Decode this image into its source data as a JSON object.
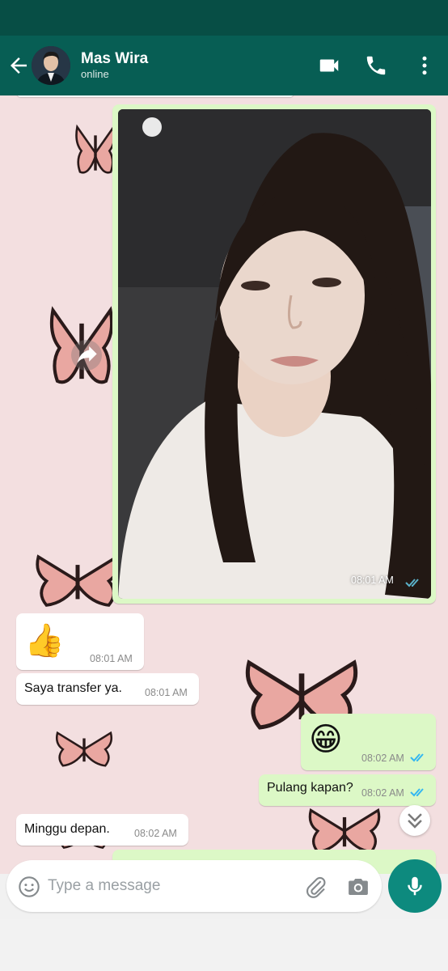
{
  "header": {
    "contact_name": "Mas Wira",
    "contact_status": "online"
  },
  "messages": [
    {
      "direction": "out",
      "type": "image",
      "time": "08:01 AM",
      "status": "read"
    },
    {
      "direction": "in",
      "type": "emoji",
      "emoji": "👍",
      "time": "08:01 AM"
    },
    {
      "direction": "in",
      "type": "text",
      "text": "Saya transfer ya.",
      "time": "08:01 AM"
    },
    {
      "direction": "out",
      "type": "emoji",
      "emoji": "😁",
      "time": "08:02 AM",
      "status": "read"
    },
    {
      "direction": "out",
      "type": "text",
      "text": "Pulang kapan?",
      "time": "08:02 AM",
      "status": "read"
    },
    {
      "direction": "in",
      "type": "text",
      "text": "Minggu depan.",
      "time": "08:02 AM"
    }
  ],
  "composer": {
    "placeholder": "Type a message"
  },
  "icons": {
    "back": "arrow-left-icon",
    "video": "video-call-icon",
    "call": "phone-icon",
    "menu": "more-vertical-icon",
    "emoji": "emoji-icon",
    "attach": "paperclip-icon",
    "camera": "camera-icon",
    "mic": "mic-icon",
    "forward": "forward-icon",
    "scroll_down": "double-chevron-down-icon"
  },
  "colors": {
    "header": "#075e54",
    "status_bar": "#074e45",
    "outgoing_bubble": "#dcf8c6",
    "incoming_bubble": "#ffffff",
    "chat_background": "#f3dfe0",
    "read_ticks": "#34b7f1",
    "mic_button": "#0d8a7e"
  }
}
